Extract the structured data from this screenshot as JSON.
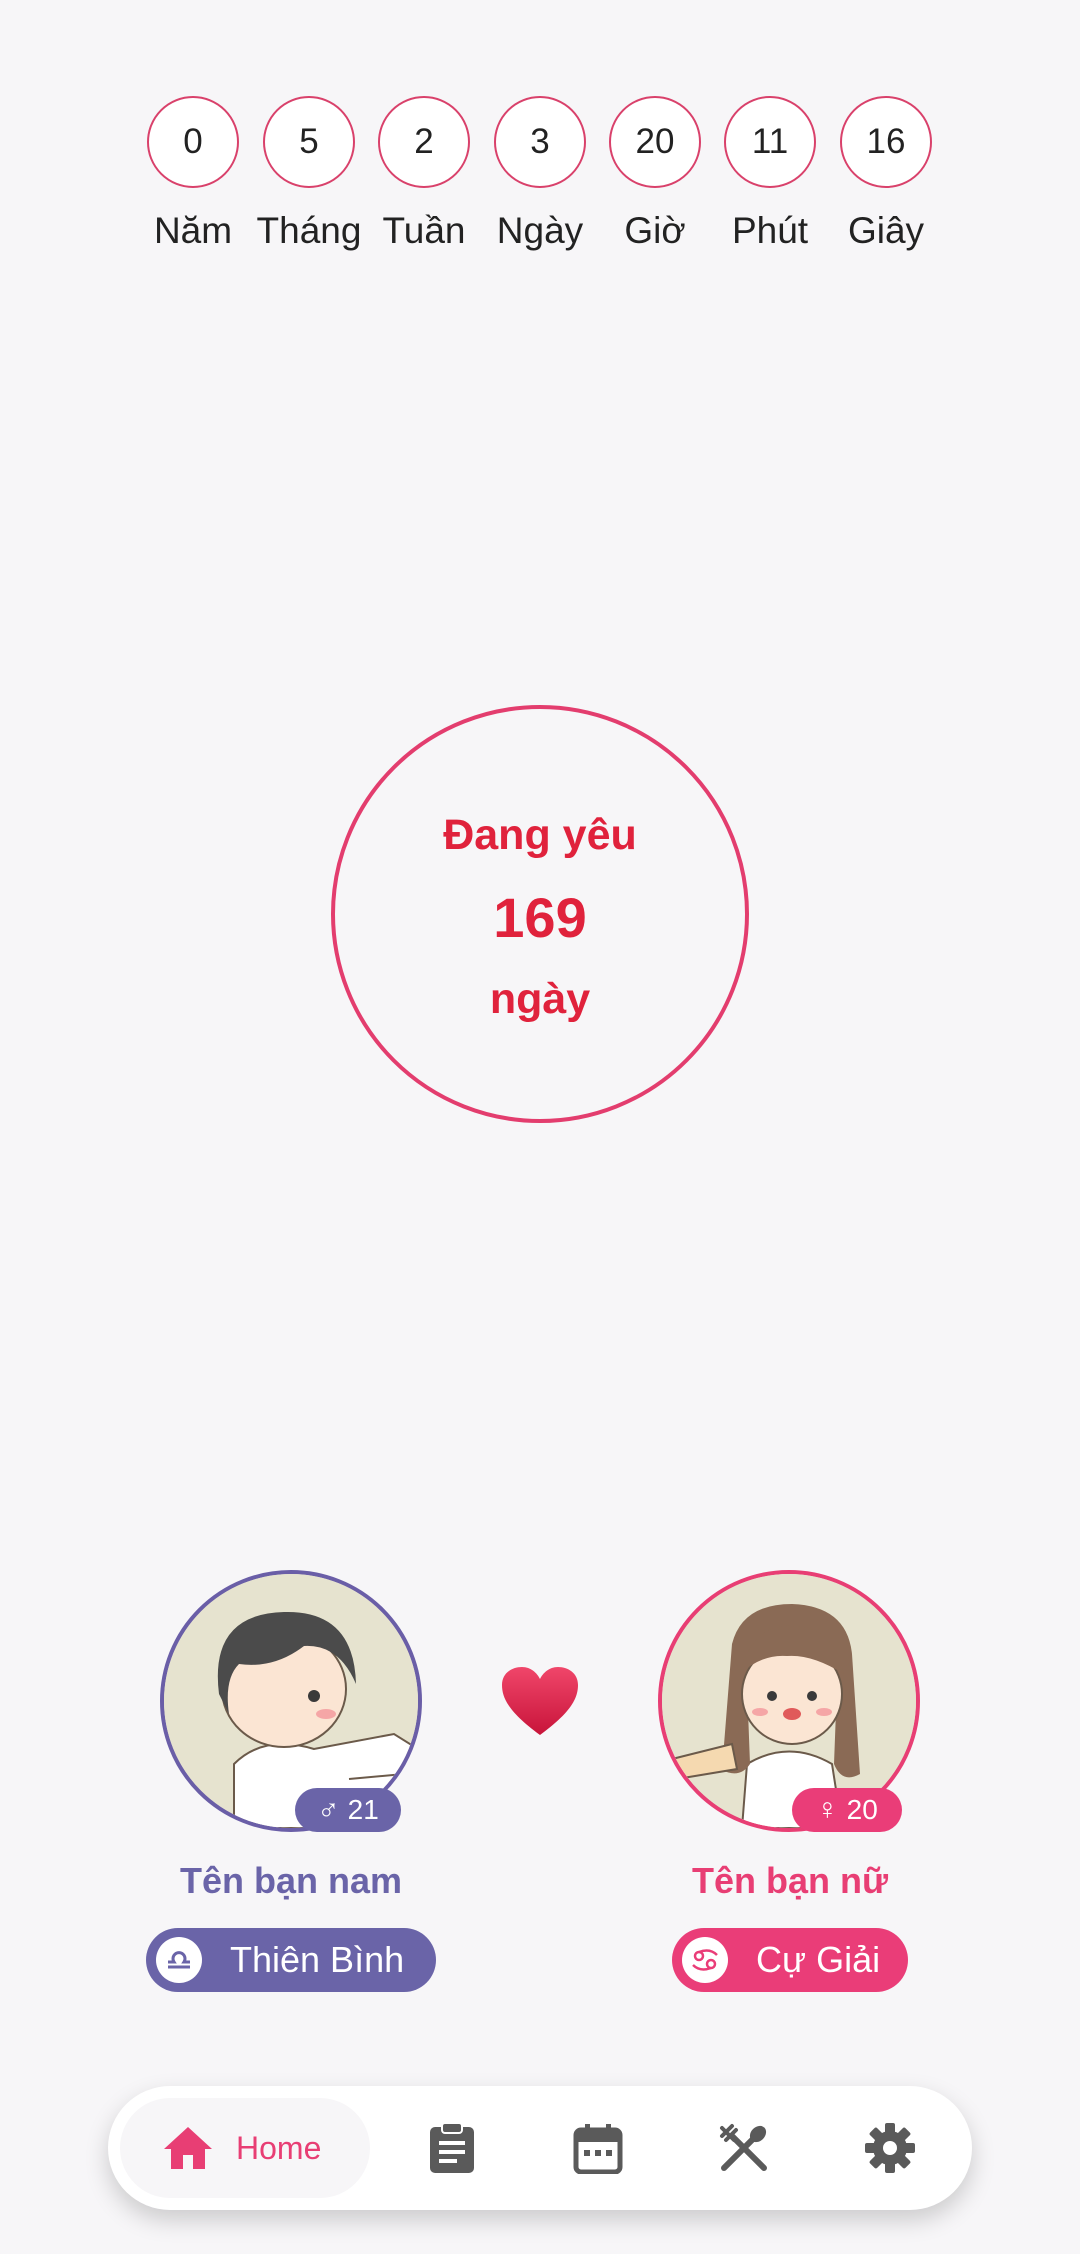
{
  "counter": {
    "units": [
      {
        "value": "0",
        "label": "Năm"
      },
      {
        "value": "5",
        "label": "Tháng"
      },
      {
        "value": "2",
        "label": "Tuần"
      },
      {
        "value": "3",
        "label": "Ngày"
      },
      {
        "value": "20",
        "label": "Giờ"
      },
      {
        "value": "11",
        "label": "Phút"
      },
      {
        "value": "16",
        "label": "Giây"
      }
    ]
  },
  "main": {
    "title": "Đang yêu",
    "days": "169",
    "unit": "ngày"
  },
  "male": {
    "age": "21",
    "name": "Tên bạn nam",
    "zodiac": "Thiên Bình",
    "icon": "libra-icon",
    "color": "#6a64a8"
  },
  "female": {
    "age": "20",
    "name": "Tên bạn nữ",
    "zodiac": "Cự Giải",
    "icon": "cancer-icon",
    "color": "#ea3d78"
  },
  "nav": {
    "home_label": "Home",
    "active_color": "#e83e74",
    "items": [
      "home-icon",
      "clipboard-icon",
      "calendar-icon",
      "utensils-icon",
      "settings-icon"
    ]
  },
  "colors": {
    "accent": "#e33d6e",
    "days_text": "#e0223c",
    "background": "#f7f6f8"
  }
}
